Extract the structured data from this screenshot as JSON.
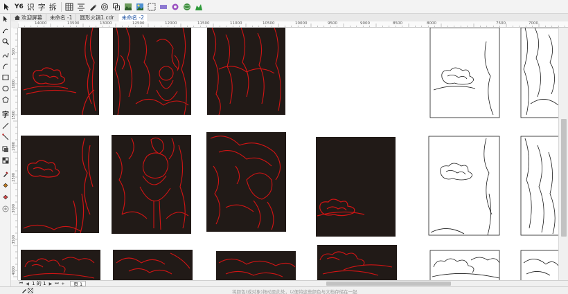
{
  "toolbar": {
    "buttons": [
      {
        "name": "pick-tool-icon",
        "label": ""
      },
      {
        "name": "ai-tool-button",
        "label": "Y6"
      },
      {
        "name": "recognize-button",
        "label": "识"
      },
      {
        "name": "text-button",
        "label": "字"
      },
      {
        "name": "split-button",
        "label": "拆"
      }
    ]
  },
  "tabs": [
    {
      "label": "欢迎屏幕",
      "home": true,
      "active": false
    },
    {
      "label": "未命名 -1",
      "home": false,
      "active": false
    },
    {
      "label": "圆形火锅1.cdr",
      "home": false,
      "active": false
    },
    {
      "label": "未命名 -2",
      "home": false,
      "active": true
    }
  ],
  "ruler": {
    "h_ticks": [
      "14000",
      "13500",
      "13000",
      "12500",
      "12000",
      "11500",
      "11000",
      "10500",
      "10000",
      "9500",
      "9000",
      "8500",
      "8000",
      "7500",
      "7000"
    ],
    "v_ticks": [
      "500",
      "1000",
      "1500",
      "2000",
      "2500",
      "3000",
      "3500",
      "4000"
    ]
  },
  "pager": {
    "current": "1",
    "of_label": "的",
    "total": "1",
    "page_tab": "页 1"
  },
  "status": {
    "message": "将颜色(或对象)拖动至此处，以便将这些颜色与文档存储在一起"
  },
  "colors": {
    "artwork_bg": "#211a17",
    "stroke_red": "#d21414",
    "stroke_black": "#1a1a1a",
    "accent": "#1a4fa0"
  }
}
